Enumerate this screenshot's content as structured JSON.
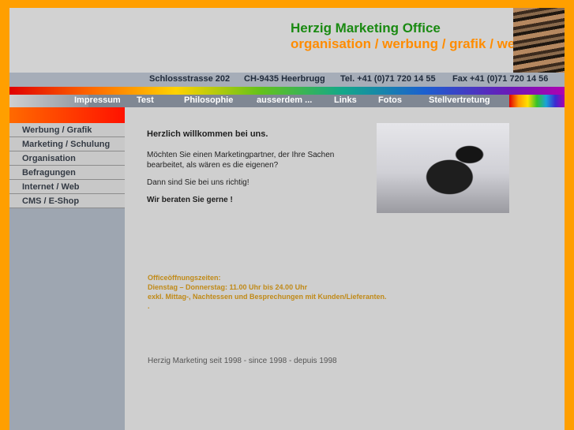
{
  "brand": {
    "title": "Herzig Marketing Office",
    "tagline": "organisation / werbung / grafik / web"
  },
  "address": {
    "street": "Schlossstrasse 202",
    "city": "CH-9435 Heerbrugg",
    "tel": "Tel. +41 (0)71 720 14 55",
    "fax": "Fax +41 (0)71 720 14 56"
  },
  "topnav": {
    "impressum": "Impressum",
    "test": "Test",
    "philosophie": "Philosophie",
    "ausserdem": "ausserdem ...",
    "links": "Links",
    "fotos": "Fotos",
    "stellvertretung": "Stellvertretung"
  },
  "sidebar": {
    "items": [
      {
        "label": "Werbung / Grafik"
      },
      {
        "label": "Marketing / Schulung"
      },
      {
        "label": "Organisation"
      },
      {
        "label": "Befragungen"
      },
      {
        "label": "Internet / Web"
      },
      {
        "label": "CMS / E-Shop"
      }
    ]
  },
  "main": {
    "welcome": "Herzlich willkommen bei uns.",
    "intro": "Möchten Sie einen Marketingpartner, der Ihre Sachen bearbeitet, als wären es die eigenen?",
    "intro2": "Dann sind Sie bei uns richtig!",
    "advice": "Wir beraten Sie gerne !",
    "hours_title": "Officeöffnungszeiten:",
    "hours_days": "Dienstag – Donnerstag: 11.00 Uhr bis 24.00 Uhr",
    "hours_note": "exkl. Mittag-, Nachtessen und Besprechungen mit Kunden/Lieferanten.",
    "hours_dot": ".",
    "footer": "Herzig Marketing seit 1998 - since 1998 - depuis 1998"
  },
  "colors": {
    "outer_border": "#ff9f00",
    "brand_green": "#1a8a12",
    "brand_orange": "#ff8c00",
    "hours_text": "#c08a18"
  }
}
